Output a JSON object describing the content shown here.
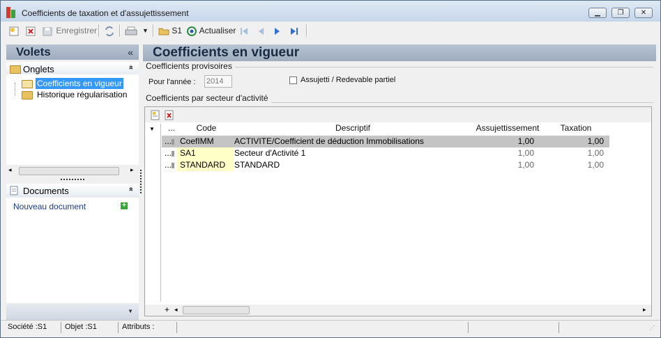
{
  "window": {
    "title": "Coefficients de taxation et d'assujettissement",
    "controls": {
      "minimize": "▁",
      "restore": "❐",
      "close": "✕"
    }
  },
  "toolbar": {
    "save_label": "Enregistrer",
    "folder_label": "S1",
    "refresh_label": "Actualiser"
  },
  "sidebar": {
    "title": "Volets",
    "collapse": "«",
    "sections": {
      "onglets": {
        "label": "Onglets",
        "chevron": "»",
        "items": [
          {
            "label": "Coefficients en vigueur",
            "selected": true
          },
          {
            "label": "Historique régularisation",
            "selected": false
          }
        ]
      },
      "documents": {
        "label": "Documents",
        "chevron": "»",
        "new_document": "Nouveau document",
        "add": "+"
      }
    },
    "footer_arrow": "▼"
  },
  "main": {
    "title": "Coefficients en vigueur",
    "provisoire": {
      "group_label": "Coefficients provisoires",
      "year_label": "Pour l'année :",
      "year_value": "2014",
      "checkbox_label": "Assujetti / Redevable partiel",
      "checkbox_checked": false
    },
    "secteur": {
      "group_label": "Coefficients par secteur d'activité",
      "columns": [
        "...",
        "Code",
        "Descriptif",
        "Assujettissement",
        "Taxation"
      ],
      "rows": [
        {
          "marker": "...",
          "code": "CoefIMM",
          "descriptif": "ACTIVITE/Coefficient de déduction Immobilisations",
          "assujettissement": "1,00",
          "taxation": "1,00",
          "selected": true
        },
        {
          "marker": "...",
          "code": "SA1",
          "descriptif": "Secteur d'Activité 1",
          "assujettissement": "1,00",
          "taxation": "1,00",
          "selected": false
        },
        {
          "marker": "...",
          "code": "STANDARD",
          "descriptif": "STANDARD",
          "assujettissement": "1,00",
          "taxation": "1,00",
          "selected": false
        }
      ],
      "add_row": "+"
    }
  },
  "status_bar": {
    "societe": "Société :S1",
    "objet": "Objet :S1",
    "attributs": "Attributs :"
  }
}
